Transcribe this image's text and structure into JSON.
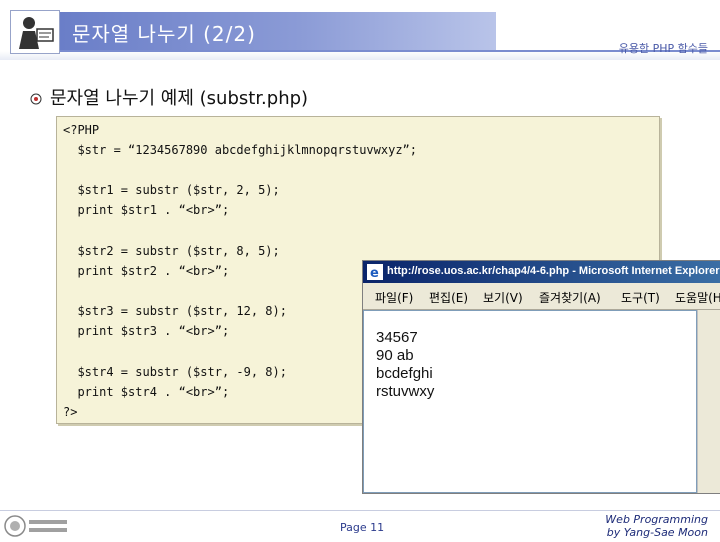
{
  "header": {
    "title": "문자열 나누기 (2/2)",
    "right_label": "유용한 PHP 함수들"
  },
  "subtitle": "문자열 나누기 예제 (substr.php)",
  "code": {
    "lines": [
      "<?PHP",
      "  $str = “1234567890 abcdefghijklmnopqrstuvwxyz”;",
      "  $str1 = substr ($str, 2, 5);",
      "  print $str1 . “<br>”;",
      "  $str2 = substr ($str, 8, 5);",
      "  print $str2 . “<br>”;",
      "  $str3 = substr ($str, 12, 8);",
      "  print $str3 . “<br>”;",
      "  $str4 = substr ($str, -9, 8);",
      "  print $str4 . “<br>”;",
      "?>"
    ]
  },
  "browser": {
    "title": "http://rose.uos.ac.kr/chap4/4-6.php - Microsoft Internet Explorer",
    "menu": [
      "파일(F)",
      "편집(E)",
      "보기(V)",
      "즐겨찾기(A)",
      "도구(T)",
      "도움말(H)"
    ],
    "output": [
      "34567",
      "90 ab",
      "bcdefghi",
      "rstuvwxy"
    ]
  },
  "footer": {
    "page": "Page 11",
    "credit_line1": "Web Programming",
    "credit_line2": "by Yang-Sae Moon"
  },
  "colors": {
    "title_band": "#6a7ec8",
    "code_background": "#f6f3d8",
    "browser_titlebar": "#0a246a"
  }
}
